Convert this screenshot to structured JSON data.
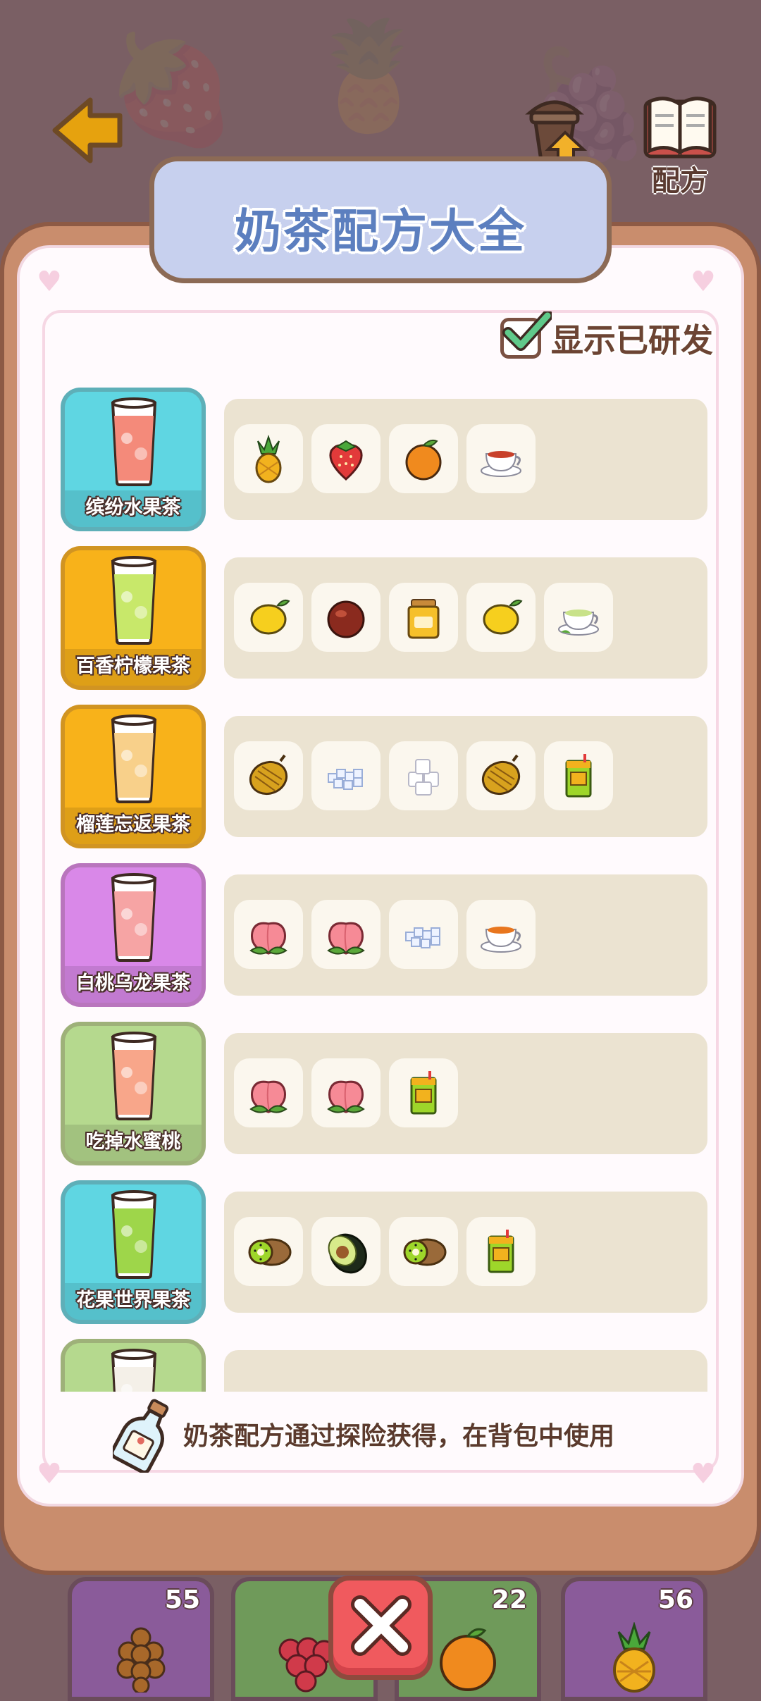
{
  "title": "奶茶配方大全",
  "top_bar": {
    "back_icon": "back-arrow-icon",
    "upgrade_label": "升级",
    "recipe_label": "配方"
  },
  "show_developed": {
    "label": "显示已研发",
    "checked": true
  },
  "recipes": [
    {
      "name": "缤纷水果茶",
      "color": "#5fd6e2",
      "ingredients": [
        "pineapple",
        "strawberry",
        "orange",
        "black-tea"
      ]
    },
    {
      "name": "百香柠檬果茶",
      "color": "#f8b21a",
      "ingredients": [
        "lemon",
        "passion-fruit",
        "honey",
        "lemon",
        "green-tea"
      ]
    },
    {
      "name": "榴莲忘返果茶",
      "color": "#f8b21a",
      "ingredients": [
        "durian",
        "crushed-ice",
        "ice-cubes",
        "durian",
        "juice-box"
      ]
    },
    {
      "name": "白桃乌龙果茶",
      "color": "#d988e8",
      "ingredients": [
        "peach",
        "peach",
        "crushed-ice",
        "oolong-tea"
      ]
    },
    {
      "name": "吃掉水蜜桃",
      "color": "#b5d98e",
      "ingredients": [
        "peach",
        "peach",
        "juice-box"
      ]
    },
    {
      "name": "花果世界果茶",
      "color": "#5fd6e2",
      "ingredients": [
        "kiwi",
        "avocado",
        "kiwi",
        "juice-box"
      ]
    },
    {
      "name": "",
      "color": "#b5d98e",
      "ingredients": []
    }
  ],
  "hint": "奶茶配方通过探险获得，在背包中使用",
  "inventory": [
    {
      "icon": "tapioca-pearls-icon",
      "count": "55"
    },
    {
      "icon": "grapes-icon",
      "count": ""
    },
    {
      "icon": "orange-icon",
      "count": "22"
    },
    {
      "icon": "pineapple-icon",
      "count": "56"
    }
  ]
}
